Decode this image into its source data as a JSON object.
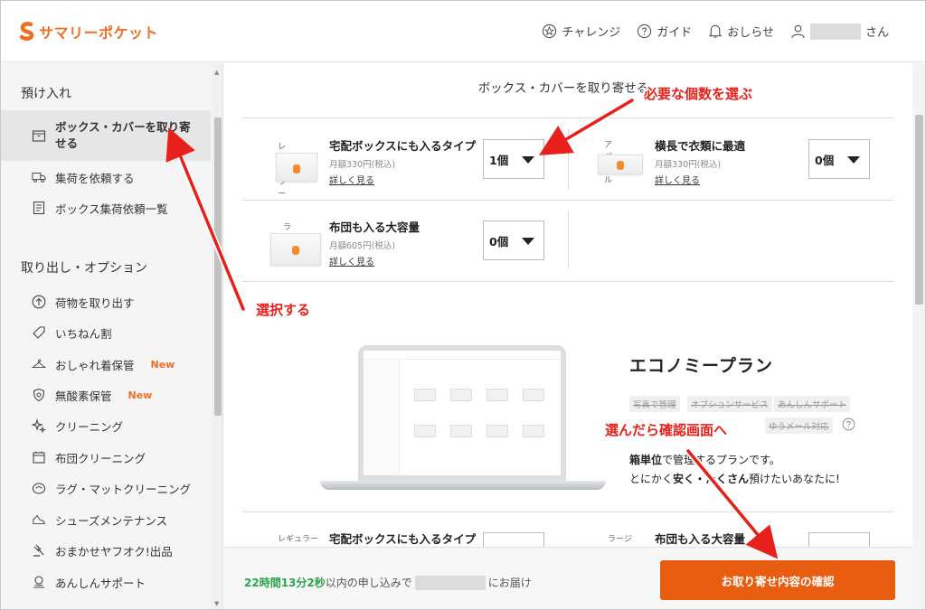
{
  "app": {
    "name": "サマリーポケット"
  },
  "header": {
    "nav": [
      {
        "label": "チャレンジ",
        "icon": "star-circle-icon"
      },
      {
        "label": "ガイド",
        "icon": "question-circle-icon"
      },
      {
        "label": "おしらせ",
        "icon": "bell-icon"
      }
    ],
    "user_suffix": "さん"
  },
  "sidebar": {
    "section_deposit": "預け入れ",
    "deposit_items": [
      {
        "label": "ボックス・カバーを取り寄せる",
        "icon": "box-icon",
        "active": true
      },
      {
        "label": "集荷を依頼する",
        "icon": "truck-icon"
      },
      {
        "label": "ボックス集荷依頼一覧",
        "icon": "document-icon"
      }
    ],
    "section_retrieve": "取り出し・オプション",
    "retrieve_items": [
      {
        "label": "荷物を取り出す",
        "icon": "upload-icon"
      },
      {
        "label": "いちねん割",
        "icon": "tag-icon"
      },
      {
        "label": "おしゃれ着保管",
        "icon": "hanger-icon",
        "badge": "New"
      },
      {
        "label": "無酸素保管",
        "icon": "shield-icon",
        "badge": "New"
      },
      {
        "label": "クリーニング",
        "icon": "sparkle-icon"
      },
      {
        "label": "布団クリーニング",
        "icon": "futon-icon"
      },
      {
        "label": "ラグ・マットクリーニング",
        "icon": "rug-icon"
      },
      {
        "label": "シューズメンテナンス",
        "icon": "shoe-icon"
      },
      {
        "label": "おまかせヤフオク!出品",
        "icon": "auction-icon"
      },
      {
        "label": "あんしんサポート",
        "icon": "support-icon"
      }
    ]
  },
  "main": {
    "title": "ボックス・カバーを取り寄せる",
    "products": [
      {
        "type": "レギュラー",
        "name": "宅配ボックスにも入るタイプ",
        "price": "月額330円(税込)",
        "more": "詳しく見る",
        "qty": "1個"
      },
      {
        "type": "アパレル",
        "name": "横長で衣類に最適",
        "price": "月額330円(税込)",
        "more": "詳しく見る",
        "qty": "0個"
      },
      {
        "type": "ラージ",
        "name": "布団も入る大容量",
        "price": "月額605円(税込)",
        "more": "詳しく見る",
        "qty": "0個"
      }
    ],
    "plan": {
      "title": "エコノミープラン",
      "tags": [
        "写真で管理",
        "オプションサービス",
        "あんしんサポート",
        "ゆうメール対応"
      ],
      "desc_bold": "箱単位",
      "desc_rest": "で管理するプランです。",
      "desc2_a": "とにかく",
      "desc2_b": "安く・たくさん",
      "desc2_c": "預けたいあなたに!"
    },
    "next_products": [
      {
        "type": "レギュラー",
        "name": "宅配ボックスにも入るタイプ"
      },
      {
        "type": "ラージ",
        "name": "布団も入る大容量"
      }
    ]
  },
  "footer": {
    "timer": "22時間13分2秒",
    "timer_text": "以内の申し込みで",
    "deliver_text": "にお届け",
    "cta": "お取り寄せ内容の確認"
  },
  "annotations": {
    "select": "選択する",
    "choose_qty": "必要な個数を選ぶ",
    "to_confirm": "選んだら確認画面へ"
  },
  "colors": {
    "brand": "#f26d21",
    "cta": "#e85d10",
    "timer": "#2aa44a",
    "annotation": "#e8201c"
  }
}
